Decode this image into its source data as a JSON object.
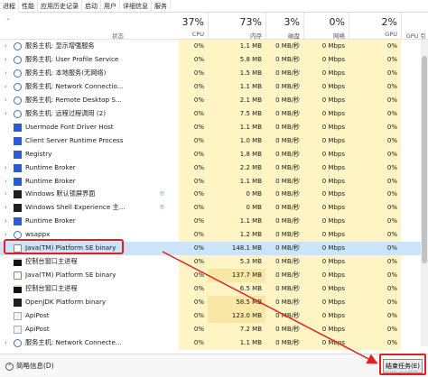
{
  "tabs": [
    "进程",
    "性能",
    "应用历史记录",
    "启动",
    "用户",
    "详细信息",
    "服务"
  ],
  "header": {
    "status_label": "状态",
    "columns": [
      {
        "pct": "37%",
        "label": "CPU"
      },
      {
        "pct": "73%",
        "label": "内存"
      },
      {
        "pct": "3%",
        "label": "磁盘"
      },
      {
        "pct": "0%",
        "label": "网络"
      },
      {
        "pct": "2%",
        "label": "GPU"
      },
      {
        "pct": "",
        "label": "GPU 引"
      }
    ]
  },
  "rows": [
    {
      "name": "服务主机: 显示增强服务",
      "icon": "gear",
      "arrow": "›",
      "cpu": "0%",
      "mem": "1.1 MB",
      "disk": "0 MB/秒",
      "net": "0 Mbps",
      "gpu": "0%"
    },
    {
      "name": "服务主机: User Profile Service",
      "icon": "gear",
      "arrow": "›",
      "cpu": "0%",
      "mem": "5.8 MB",
      "disk": "0 MB/秒",
      "net": "0 Mbps",
      "gpu": "0%"
    },
    {
      "name": "服务主机: 本地服务(无网络)",
      "icon": "gear",
      "arrow": "›",
      "cpu": "0%",
      "mem": "1.5 MB",
      "disk": "0 MB/秒",
      "net": "0 Mbps",
      "gpu": "0%"
    },
    {
      "name": "服务主机: Network Connectio...",
      "icon": "gear",
      "arrow": "›",
      "cpu": "0%",
      "mem": "1.1 MB",
      "disk": "0 MB/秒",
      "net": "0 Mbps",
      "gpu": "0%"
    },
    {
      "name": "服务主机: Remote Desktop S...",
      "icon": "gear",
      "arrow": "›",
      "cpu": "0%",
      "mem": "2.1 MB",
      "disk": "0 MB/秒",
      "net": "0 Mbps",
      "gpu": "0%"
    },
    {
      "name": "服务主机: 远程过程调用 (2)",
      "icon": "gear",
      "arrow": "›",
      "cpu": "0%",
      "mem": "7.5 MB",
      "disk": "0 MB/秒",
      "net": "0 Mbps",
      "gpu": "0%"
    },
    {
      "name": "Usermode Font Driver Host",
      "icon": "blue",
      "arrow": "",
      "cpu": "0%",
      "mem": "1.1 MB",
      "disk": "0 MB/秒",
      "net": "0 Mbps",
      "gpu": "0%"
    },
    {
      "name": "Client Server Runtime Process",
      "icon": "blue",
      "arrow": "",
      "cpu": "0%",
      "mem": "1.0 MB",
      "disk": "0 MB/秒",
      "net": "0 Mbps",
      "gpu": "0%"
    },
    {
      "name": "Registry",
      "icon": "blue",
      "arrow": "",
      "cpu": "0%",
      "mem": "1.8 MB",
      "disk": "0 MB/秒",
      "net": "0 Mbps",
      "gpu": "0%"
    },
    {
      "name": "Runtime Broker",
      "icon": "blue",
      "arrow": "›",
      "cpu": "0%",
      "mem": "2.2 MB",
      "disk": "0 MB/秒",
      "net": "0 Mbps",
      "gpu": "0%"
    },
    {
      "name": "Runtime Broker",
      "icon": "blue",
      "arrow": "›",
      "cpu": "0%",
      "mem": "1.1 MB",
      "disk": "0 MB/秒",
      "net": "0 Mbps",
      "gpu": "0%"
    },
    {
      "name": "Windows 默认锁屏界面",
      "icon": "win",
      "arrow": "›",
      "cpu": "0%",
      "mem": "0 MB",
      "disk": "0 MB/秒",
      "net": "0 Mbps",
      "gpu": "0%",
      "leaf": true
    },
    {
      "name": "Windows Shell Experience 主...",
      "icon": "win",
      "arrow": "›",
      "cpu": "0%",
      "mem": "0 MB",
      "disk": "0 MB/秒",
      "net": "0 Mbps",
      "gpu": "0%",
      "leaf": true
    },
    {
      "name": "Runtime Broker",
      "icon": "blue",
      "arrow": "›",
      "cpu": "0%",
      "mem": "1.1 MB",
      "disk": "0 MB/秒",
      "net": "0 Mbps",
      "gpu": "0%"
    },
    {
      "name": "wsappx",
      "icon": "gear",
      "arrow": "›",
      "cpu": "0%",
      "mem": "1.2 MB",
      "disk": "0 MB/秒",
      "net": "0 Mbps",
      "gpu": "0%"
    },
    {
      "name": "Java(TM) Platform SE binary",
      "icon": "java",
      "arrow": "",
      "cpu": "0%",
      "mem": "148.1 MB",
      "disk": "0 MB/秒",
      "net": "0 Mbps",
      "gpu": "0%",
      "selected": true
    },
    {
      "name": "控制台窗口主进程",
      "icon": "cmd",
      "arrow": "",
      "cpu": "0%",
      "mem": "5.3 MB",
      "disk": "0 MB/秒",
      "net": "0 Mbps",
      "gpu": "0%"
    },
    {
      "name": "Java(TM) Platform SE binary",
      "icon": "java",
      "arrow": "",
      "cpu": "0%",
      "mem": "137.7 MB",
      "disk": "0 MB/秒",
      "net": "0 Mbps",
      "gpu": "0%",
      "hot": true
    },
    {
      "name": "控制台窗口主进程",
      "icon": "cmd",
      "arrow": "",
      "cpu": "0%",
      "mem": "6.5 MB",
      "disk": "0 MB/秒",
      "net": "0 Mbps",
      "gpu": "0%"
    },
    {
      "name": "OpenJDK Platform binary",
      "icon": "win",
      "arrow": "",
      "cpu": "0%",
      "mem": "58.5 MB",
      "disk": "0 MB/秒",
      "net": "0 Mbps",
      "gpu": "0%",
      "hot": true
    },
    {
      "name": "ApiPost",
      "icon": "doc",
      "arrow": "",
      "cpu": "0%",
      "mem": "123.0 MB",
      "disk": "0 MB/秒",
      "net": "0 Mbps",
      "gpu": "0%",
      "hot": true
    },
    {
      "name": "ApiPost",
      "icon": "doc",
      "arrow": "",
      "cpu": "0%",
      "mem": "7.2 MB",
      "disk": "0 MB/秒",
      "net": "0 Mbps",
      "gpu": "0%"
    },
    {
      "name": "服务主机: Network Connecte...",
      "icon": "gear",
      "arrow": "›",
      "cpu": "0%",
      "mem": "1.1 MB",
      "disk": "0 MB/秒",
      "net": "0 Mbps",
      "gpu": "0%"
    }
  ],
  "footer": {
    "less_label": "简略信息(D)",
    "end_task_label": "结束任务(E)"
  },
  "watermark": "CSDN @小饭饭"
}
